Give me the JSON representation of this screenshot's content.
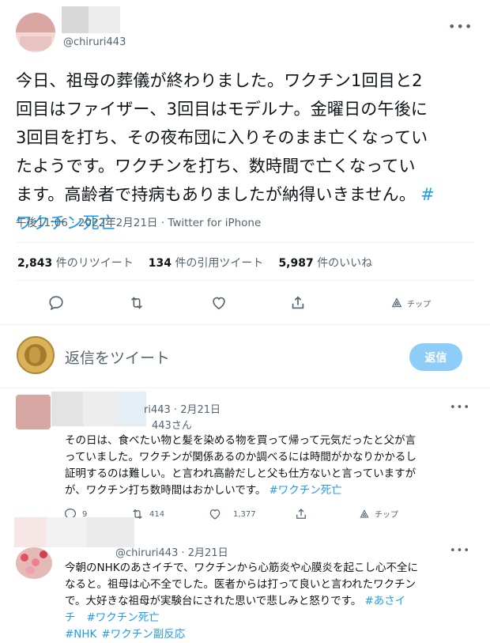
{
  "tweet": {
    "handle": "@chiruri443",
    "text_lines": [
      "今日、祖母の葬儀が終わりました。ワクチン1回目と2",
      "回目はファイザー、3回目はモデルナ。金曜日の午後に",
      "3回目を打ち、その夜布団に入りそのまま亡くなってい",
      "たようです。ワクチンを打ち、数時間で亡くなってい",
      "ます。高齢者で持病もありましたが納得いきません。"
    ],
    "hashtag_inline": "#",
    "hashtag_line": "ワクチン死亡",
    "time": "午後11:06",
    "date": "2022年2月21日",
    "source": "Twitter for iPhone",
    "separator": "·"
  },
  "stats": {
    "retweets_count": "2,843",
    "retweets_label": "件のリツイート",
    "quotes_count": "134",
    "quotes_label": "件の引用ツイート",
    "likes_count": "5,987",
    "likes_label": "件のいいね"
  },
  "actions": {
    "tip_label": "チップ"
  },
  "compose": {
    "placeholder": "返信をツイート",
    "button_label": "返信"
  },
  "replies": [
    {
      "handle_fragment": "ri443",
      "separator": "·",
      "date": "2月21日",
      "replying_to": "443さん",
      "text_lines": [
        "その日は、食べたい物と髪を染める物を買って帰って元気だったと父が言",
        "っていました。ワクチンが関係あるのか調べるには時間がかなりかかるし",
        "証明するのは難しい。と言われ高齢だしと父も仕方ないと言っていますが",
        "が、ワクチン打ち数時間はおかしいです。"
      ],
      "hashtag": "#ワクチン死亡",
      "reply_count": "9",
      "retweet_count": "414",
      "like_count": "1,377",
      "tip_label": "チップ"
    },
    {
      "handle": "@chiruri443",
      "separator": "·",
      "date": "2月21日",
      "text_lines": [
        "今朝のNHKのあさイチで、ワクチンから心筋炎や心膜炎を起こし心不全に",
        "なると。祖母は心不全でした。医者からは打って良いと言われたワクチン",
        "で。大好きな祖母が実験台にされた思いで悲しみと怒りです。"
      ],
      "hashtag_1": "#あさイ",
      "hashtag_1_cont": "チ",
      "hashtag_2": "#ワクチン死亡",
      "hashtag_3": "#NHK",
      "hashtag_4": "#ワクチン副反応"
    }
  ],
  "colors": {
    "accent": "#1d9bf0",
    "secondary_text": "#536471",
    "reply_button": "#8ecdf8"
  }
}
